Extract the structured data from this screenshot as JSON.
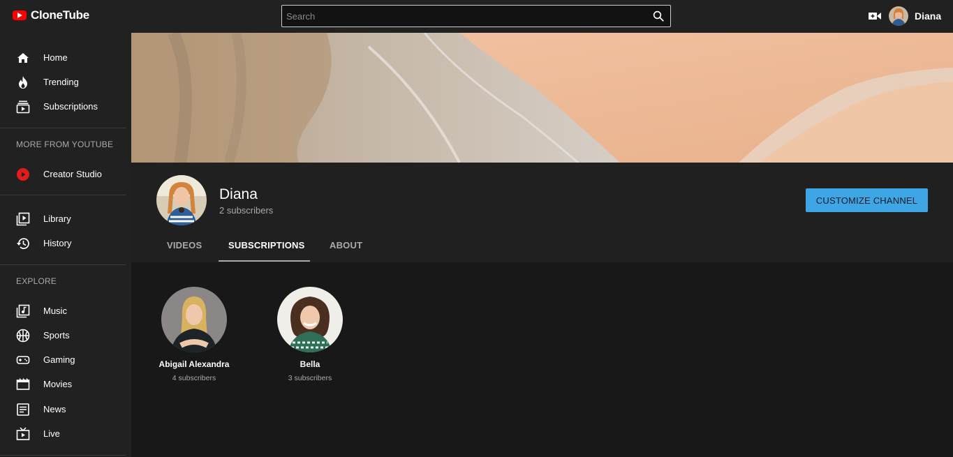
{
  "app": {
    "name": "CloneTube"
  },
  "search": {
    "placeholder": "Search"
  },
  "user": {
    "name": "Diana"
  },
  "sidebar": {
    "main_items": [
      {
        "label": "Home",
        "icon": "home-icon"
      },
      {
        "label": "Trending",
        "icon": "fire-icon"
      },
      {
        "label": "Subscriptions",
        "icon": "subscriptions-icon"
      }
    ],
    "more_title": "MORE FROM YOUTUBE",
    "more_items": [
      {
        "label": "Creator Studio",
        "icon": "youtube-play-icon"
      }
    ],
    "library_items": [
      {
        "label": "Library",
        "icon": "library-icon"
      },
      {
        "label": "History",
        "icon": "history-icon"
      }
    ],
    "explore_title": "EXPLORE",
    "explore_items": [
      {
        "label": "Music",
        "icon": "music-icon"
      },
      {
        "label": "Sports",
        "icon": "sports-icon"
      },
      {
        "label": "Gaming",
        "icon": "gaming-icon"
      },
      {
        "label": "Movies",
        "icon": "movies-icon"
      },
      {
        "label": "News",
        "icon": "news-icon"
      },
      {
        "label": "Live",
        "icon": "live-icon"
      }
    ]
  },
  "channel": {
    "name": "Diana",
    "subscribers": "2 subscribers",
    "customize_label": "CUSTOMIZE CHANNEL",
    "tabs": [
      {
        "label": "VIDEOS",
        "active": false
      },
      {
        "label": "SUBSCRIPTIONS",
        "active": true
      },
      {
        "label": "ABOUT",
        "active": false
      }
    ]
  },
  "subscriptions": [
    {
      "name": "Abigail Alexandra",
      "subscribers": "4 subscribers"
    },
    {
      "name": "Bella",
      "subscribers": "3 subscribers"
    }
  ],
  "colors": {
    "brand": "#ff0000",
    "accent": "#3ea6e5",
    "background": "#181818",
    "surface": "#212121"
  }
}
